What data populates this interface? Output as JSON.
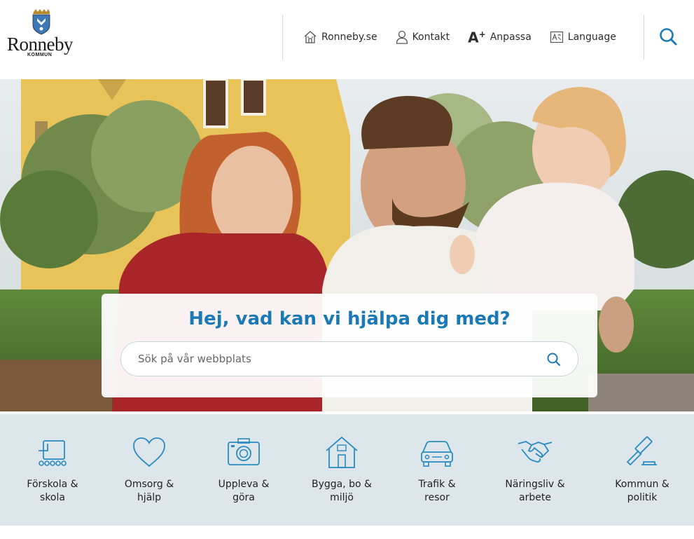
{
  "header": {
    "logo": {
      "name": "Ronneby",
      "sub": "KOMMUN"
    },
    "nav": [
      {
        "label": "Ronneby.se",
        "icon": "house-icon"
      },
      {
        "label": "Kontakt",
        "icon": "person-icon"
      },
      {
        "label": "Anpassa",
        "icon": "text-size-icon"
      },
      {
        "label": "Language",
        "icon": "translate-icon"
      }
    ],
    "search_icon": "search-icon"
  },
  "hero": {
    "image": "family-photo",
    "title": "Hej, vad kan vi hjälpa dig med?",
    "search_placeholder": "Sök på vår webbplats"
  },
  "categories": [
    {
      "label": "Förskola &\nskola",
      "icon": "school-icon"
    },
    {
      "label": "Omsorg &\nhjälp",
      "icon": "heart-icon"
    },
    {
      "label": "Uppleva &\ngöra",
      "icon": "camera-icon"
    },
    {
      "label": "Bygga, bo &\nmiljö",
      "icon": "house-icon"
    },
    {
      "label": "Trafik &\nresor",
      "icon": "car-icon"
    },
    {
      "label": "Näringsliv &\narbete",
      "icon": "handshake-icon"
    },
    {
      "label": "Kommun &\npolitik",
      "icon": "gavel-icon"
    }
  ],
  "colors": {
    "accent": "#1b7ab5",
    "icon_blue": "#2a8ac0",
    "category_bg": "#dde7eb"
  }
}
